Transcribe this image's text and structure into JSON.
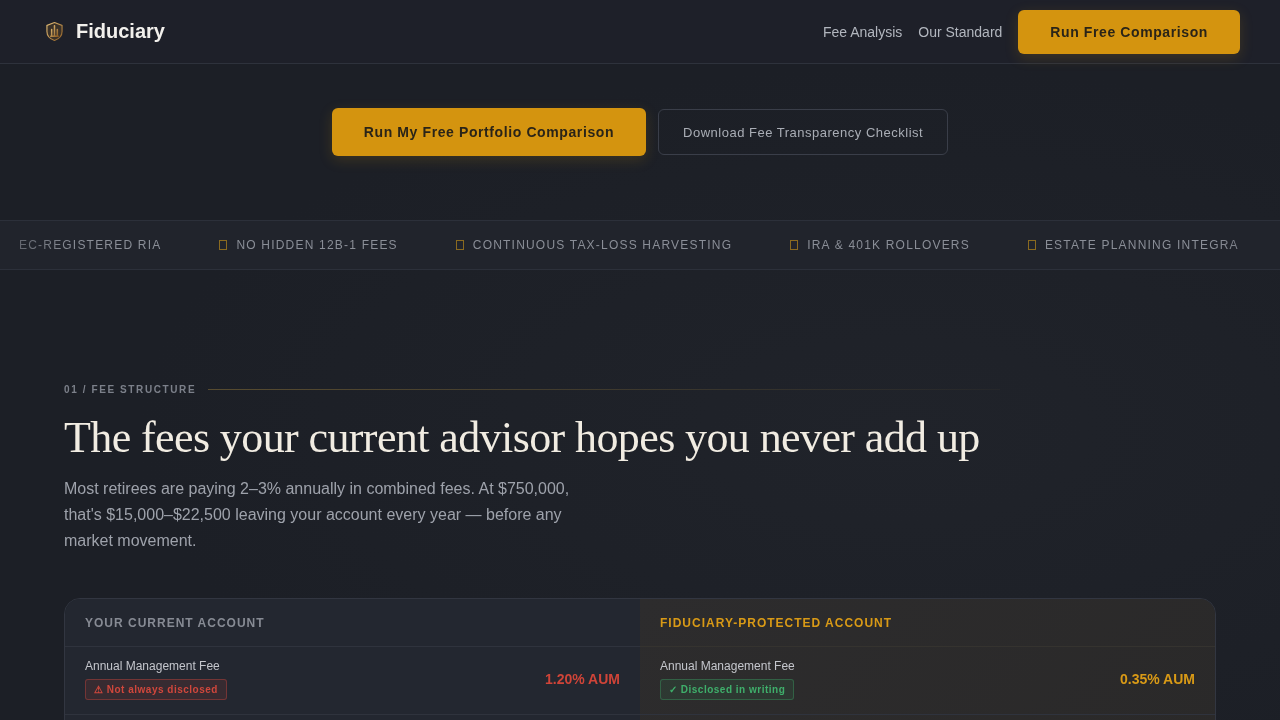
{
  "header": {
    "brand": "Fiduciary",
    "nav_links": [
      "Fee Analysis",
      "Our Standard"
    ],
    "cta": "Run Free Comparison"
  },
  "hero": {
    "buttons": [
      {
        "label": "Run My Free Portfolio Comparison",
        "kind": "primary"
      },
      {
        "label": "Download Fee Transparency Checklist",
        "kind": "secondary"
      }
    ]
  },
  "ticker": {
    "items": [
      {
        "label": "EC-REGISTERED RIA",
        "icon": false
      },
      {
        "label": "NO HIDDEN 12B-1 FEES",
        "icon": true
      },
      {
        "label": "CONTINUOUS TAX-LOSS HARVESTING",
        "icon": true
      },
      {
        "label": "IRA & 401K ROLLOVERS",
        "icon": true
      },
      {
        "label": "ESTATE PLANNING INTEGRA",
        "icon": true
      }
    ]
  },
  "fee_section": {
    "eyebrow": "01 / FEE STRUCTURE",
    "title": "The fees your current advisor hopes you never add up",
    "intro": "Most retirees are paying 2–3% annually in combined fees. At $750,000, that's $15,000–$22,500 leaving your account every year — before any market movement.",
    "comparison": {
      "columns": [
        {
          "heading": "YOUR CURRENT ACCOUNT",
          "kind": "current",
          "rows": [
            {
              "label": "Annual Management Fee",
              "badge": {
                "text": "⚠ Not always disclosed",
                "kind": "warning"
              },
              "value": "1.20% AUM"
            }
          ]
        },
        {
          "heading": "FIDUCIARY-PROTECTED ACCOUNT",
          "kind": "protected",
          "rows": [
            {
              "label": "Annual Management Fee",
              "badge": {
                "text": "✓ Disclosed in writing",
                "kind": "ok"
              },
              "value": "0.35% AUM"
            }
          ]
        }
      ]
    }
  }
}
